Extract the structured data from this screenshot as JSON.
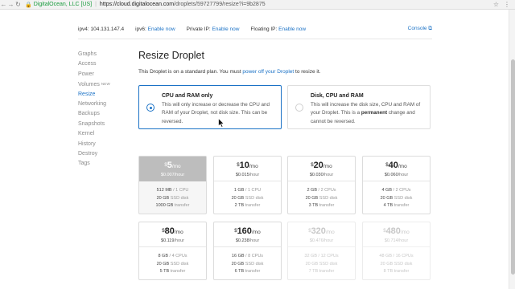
{
  "browser": {
    "site_name": "DigitalOcean, LLC [US]",
    "url_host": "https://cloud.digitalocean.com",
    "url_path": "/droplets/59727799/resize?i=9b2875",
    "icons": [
      "back-icon",
      "forward-icon",
      "reload-icon",
      "lock-icon",
      "star-icon",
      "menu-icon"
    ]
  },
  "info": {
    "ipv4_label": "ipv4:",
    "ipv4_value": "104.131.147.4",
    "ipv6_label": "ipv6:",
    "ipv6_link": "Enable now",
    "private_label": "Private IP:",
    "private_link": "Enable now",
    "floating_label": "Floating IP:",
    "floating_link": "Enable now",
    "console_label": "Console"
  },
  "sidebar": {
    "items": [
      {
        "label": "Graphs"
      },
      {
        "label": "Access"
      },
      {
        "label": "Power"
      },
      {
        "label": "Volumes",
        "badge": "NEW"
      },
      {
        "label": "Resize",
        "active": true
      },
      {
        "label": "Networking"
      },
      {
        "label": "Backups"
      },
      {
        "label": "Snapshots"
      },
      {
        "label": "Kernel"
      },
      {
        "label": "History"
      },
      {
        "label": "Destroy"
      },
      {
        "label": "Tags"
      }
    ]
  },
  "main": {
    "title": "Resize Droplet",
    "intro_prefix": "This Droplet is on a standard plan. You must ",
    "intro_link": "power off your Droplet",
    "intro_suffix": " to resize it.",
    "options": [
      {
        "title": "CPU and RAM only",
        "desc": "This will only increase or decrease the CPU and RAM of your Droplet, not disk size. This can be reversed.",
        "selected": true
      },
      {
        "title": "Disk, CPU and RAM",
        "desc_prefix": "This will increase the disk size, CPU and RAM of your Droplet. This is a ",
        "desc_bold": "permanent",
        "desc_suffix": " change and cannot be reversed.",
        "selected": false
      }
    ]
  },
  "plans": [
    {
      "dollar": "$",
      "price": "5",
      "per_mo": "/mo",
      "hourly": "$0.007",
      "per_hour": "/hour",
      "ram": "512 MB",
      "cpu": "1 CPU",
      "disk": "20 GB",
      "disk_unit": "SSD disk",
      "transfer": "1000 GB",
      "transfer_unit": "transfer",
      "state": "current"
    },
    {
      "dollar": "$",
      "price": "10",
      "per_mo": "/mo",
      "hourly": "$0.015",
      "per_hour": "/hour",
      "ram": "1 GB",
      "cpu": "1 CPU",
      "disk": "20 GB",
      "disk_unit": "SSD disk",
      "transfer": "2 TB",
      "transfer_unit": "transfer",
      "state": "available"
    },
    {
      "dollar": "$",
      "price": "20",
      "per_mo": "/mo",
      "hourly": "$0.030",
      "per_hour": "/hour",
      "ram": "2 GB",
      "cpu": "2 CPUs",
      "disk": "20 GB",
      "disk_unit": "SSD disk",
      "transfer": "3 TB",
      "transfer_unit": "transfer",
      "state": "available"
    },
    {
      "dollar": "$",
      "price": "40",
      "per_mo": "/mo",
      "hourly": "$0.060",
      "per_hour": "/hour",
      "ram": "4 GB",
      "cpu": "2 CPUs",
      "disk": "20 GB",
      "disk_unit": "SSD disk",
      "transfer": "4 TB",
      "transfer_unit": "transfer",
      "state": "available"
    },
    {
      "dollar": "$",
      "price": "80",
      "per_mo": "/mo",
      "hourly": "$0.119",
      "per_hour": "/hour",
      "ram": "8 GB",
      "cpu": "4 CPUs",
      "disk": "20 GB",
      "disk_unit": "SSD disk",
      "transfer": "5 TB",
      "transfer_unit": "transfer",
      "state": "available"
    },
    {
      "dollar": "$",
      "price": "160",
      "per_mo": "/mo",
      "hourly": "$0.238",
      "per_hour": "/hour",
      "ram": "16 GB",
      "cpu": "8 CPUs",
      "disk": "20 GB",
      "disk_unit": "SSD disk",
      "transfer": "6 TB",
      "transfer_unit": "transfer",
      "state": "available"
    },
    {
      "dollar": "$",
      "price": "320",
      "per_mo": "/mo",
      "hourly": "$0.476",
      "per_hour": "/hour",
      "ram": "32 GB",
      "cpu": "12 CPUs",
      "disk": "20 GB",
      "disk_unit": "SSD disk",
      "transfer": "7 TB",
      "transfer_unit": "transfer",
      "state": "disabled"
    },
    {
      "dollar": "$",
      "price": "480",
      "per_mo": "/mo",
      "hourly": "$0.714",
      "per_hour": "/hour",
      "ram": "48 GB",
      "cpu": "16 CPUs",
      "disk": "20 GB",
      "disk_unit": "SSD disk",
      "transfer": "8 TB",
      "transfer_unit": "transfer",
      "state": "disabled"
    }
  ],
  "colors": {
    "accent": "#1b72c6",
    "current_plan": "#bdbdbd",
    "secure": "#1a9c3e"
  }
}
